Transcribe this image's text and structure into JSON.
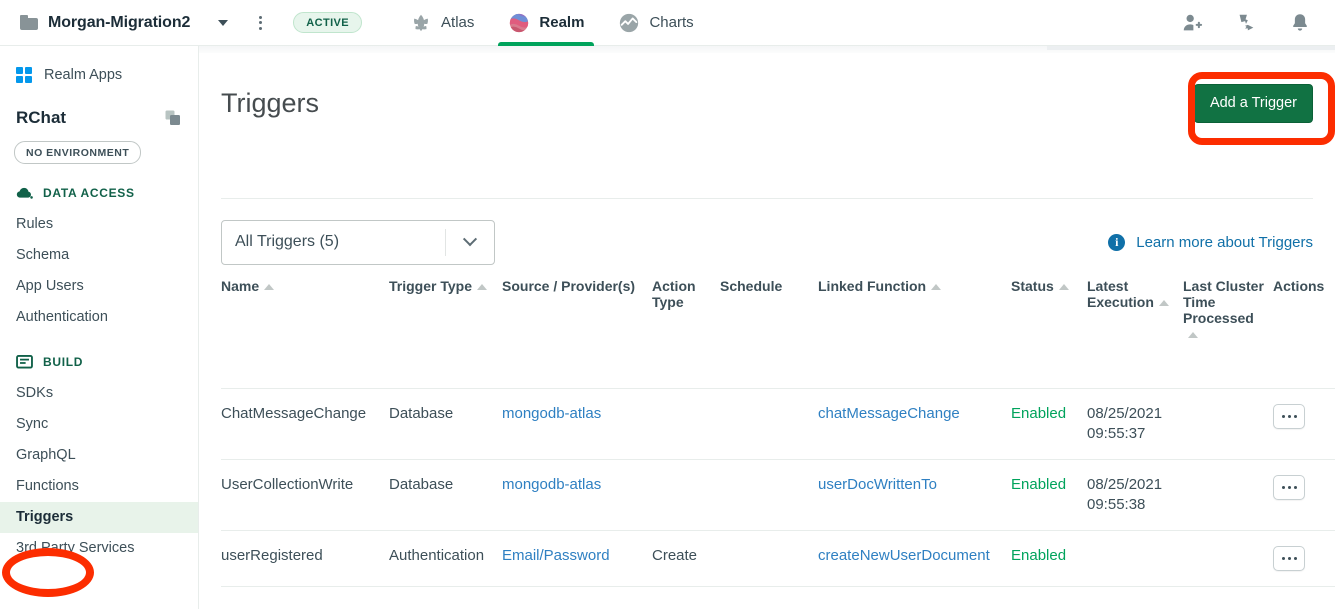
{
  "topbar": {
    "project_name": "Morgan-Migration2",
    "folder_icon": "folder-icon",
    "caret_icon": "chevron-down-icon",
    "kebab_icon": "kebab-menu-icon",
    "status_badge": "ACTIVE",
    "tabs": [
      {
        "label": "Atlas",
        "icon": "atlas-leaf-icon",
        "active": false
      },
      {
        "label": "Realm",
        "icon": "realm-circle-icon",
        "active": true
      },
      {
        "label": "Charts",
        "icon": "charts-icon",
        "active": false
      }
    ],
    "right_icons": [
      {
        "name": "invite-user-icon"
      },
      {
        "name": "support-icon"
      },
      {
        "name": "notifications-bell-icon"
      }
    ]
  },
  "sidebar": {
    "realm_apps_label": "Realm Apps",
    "realm_apps_icon": "grid-icon",
    "app_name": "RChat",
    "copy_icon": "copy-icon",
    "environment_badge": "NO ENVIRONMENT",
    "sections": [
      {
        "title": "DATA ACCESS",
        "icon": "cloud-icon",
        "items": [
          {
            "label": "Rules",
            "active": false
          },
          {
            "label": "Schema",
            "active": false
          },
          {
            "label": "App Users",
            "active": false
          },
          {
            "label": "Authentication",
            "active": false
          }
        ]
      },
      {
        "title": "BUILD",
        "icon": "build-icon",
        "items": [
          {
            "label": "SDKs",
            "active": false
          },
          {
            "label": "Sync",
            "active": false
          },
          {
            "label": "GraphQL",
            "active": false
          },
          {
            "label": "Functions",
            "active": false
          },
          {
            "label": "Triggers",
            "active": true
          },
          {
            "label": "3rd Party Services",
            "active": false
          }
        ]
      }
    ]
  },
  "main": {
    "page_title": "Triggers",
    "add_button_label": "Add a Trigger",
    "filter_selected": "All Triggers (5)",
    "filter_caret_icon": "chevron-down-icon",
    "info_icon": "info-icon",
    "info_icon_glyph": "i",
    "learn_more_label": "Learn more about Triggers",
    "table": {
      "columns": [
        {
          "label": "Name",
          "sortable": true
        },
        {
          "label": "Trigger Type",
          "sortable": true
        },
        {
          "label": "Source / Provider(s)",
          "sortable": false
        },
        {
          "label": "Action Type",
          "sortable": false
        },
        {
          "label": "Schedule",
          "sortable": false
        },
        {
          "label": "Linked Function",
          "sortable": true
        },
        {
          "label": "Status",
          "sortable": true
        },
        {
          "label": "Latest Execution",
          "sortable": true
        },
        {
          "label": "Last Cluster Time Processed",
          "sortable": true
        },
        {
          "label": "Actions",
          "sortable": false
        }
      ],
      "rows": [
        {
          "name": "ChatMessageChange",
          "trigger_type": "Database",
          "source": "mongodb-atlas",
          "action_type": "",
          "schedule": "",
          "linked_function": "chatMessageChange",
          "status": "Enabled",
          "latest_execution": "08/25/2021 09:55:37",
          "last_cluster_time": "",
          "actions_icon": "ellipsis-menu-icon"
        },
        {
          "name": "UserCollectionWrite",
          "trigger_type": "Database",
          "source": "mongodb-atlas",
          "action_type": "",
          "schedule": "",
          "linked_function": "userDocWrittenTo",
          "status": "Enabled",
          "latest_execution": "08/25/2021 09:55:38",
          "last_cluster_time": "",
          "actions_icon": "ellipsis-menu-icon"
        },
        {
          "name": "userRegistered",
          "trigger_type": "Authentication",
          "source": "Email/Password",
          "action_type": "Create",
          "schedule": "",
          "linked_function": "createNewUserDocument",
          "status": "Enabled",
          "latest_execution": "",
          "last_cluster_time": "",
          "actions_icon": "ellipsis-menu-icon"
        }
      ]
    }
  },
  "colors": {
    "brand_green": "#117243",
    "accent_green": "#00a35c",
    "link_blue": "#2f80c2",
    "info_blue": "#1070a8",
    "annotation_red": "#fc2d00",
    "text_dark": "#1c2d38",
    "text_body": "#3d4f58"
  }
}
